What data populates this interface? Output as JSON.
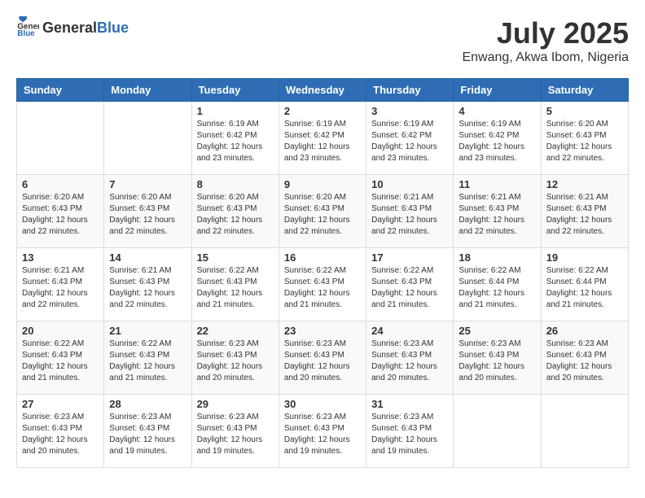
{
  "header": {
    "logo_general": "General",
    "logo_blue": "Blue",
    "month": "July 2025",
    "location": "Enwang, Akwa Ibom, Nigeria"
  },
  "weekdays": [
    "Sunday",
    "Monday",
    "Tuesday",
    "Wednesday",
    "Thursday",
    "Friday",
    "Saturday"
  ],
  "weeks": [
    [
      {
        "day": "",
        "detail": ""
      },
      {
        "day": "",
        "detail": ""
      },
      {
        "day": "1",
        "detail": "Sunrise: 6:19 AM\nSunset: 6:42 PM\nDaylight: 12 hours and 23 minutes."
      },
      {
        "day": "2",
        "detail": "Sunrise: 6:19 AM\nSunset: 6:42 PM\nDaylight: 12 hours and 23 minutes."
      },
      {
        "day": "3",
        "detail": "Sunrise: 6:19 AM\nSunset: 6:42 PM\nDaylight: 12 hours and 23 minutes."
      },
      {
        "day": "4",
        "detail": "Sunrise: 6:19 AM\nSunset: 6:42 PM\nDaylight: 12 hours and 23 minutes."
      },
      {
        "day": "5",
        "detail": "Sunrise: 6:20 AM\nSunset: 6:43 PM\nDaylight: 12 hours and 22 minutes."
      }
    ],
    [
      {
        "day": "6",
        "detail": "Sunrise: 6:20 AM\nSunset: 6:43 PM\nDaylight: 12 hours and 22 minutes."
      },
      {
        "day": "7",
        "detail": "Sunrise: 6:20 AM\nSunset: 6:43 PM\nDaylight: 12 hours and 22 minutes."
      },
      {
        "day": "8",
        "detail": "Sunrise: 6:20 AM\nSunset: 6:43 PM\nDaylight: 12 hours and 22 minutes."
      },
      {
        "day": "9",
        "detail": "Sunrise: 6:20 AM\nSunset: 6:43 PM\nDaylight: 12 hours and 22 minutes."
      },
      {
        "day": "10",
        "detail": "Sunrise: 6:21 AM\nSunset: 6:43 PM\nDaylight: 12 hours and 22 minutes."
      },
      {
        "day": "11",
        "detail": "Sunrise: 6:21 AM\nSunset: 6:43 PM\nDaylight: 12 hours and 22 minutes."
      },
      {
        "day": "12",
        "detail": "Sunrise: 6:21 AM\nSunset: 6:43 PM\nDaylight: 12 hours and 22 minutes."
      }
    ],
    [
      {
        "day": "13",
        "detail": "Sunrise: 6:21 AM\nSunset: 6:43 PM\nDaylight: 12 hours and 22 minutes."
      },
      {
        "day": "14",
        "detail": "Sunrise: 6:21 AM\nSunset: 6:43 PM\nDaylight: 12 hours and 22 minutes."
      },
      {
        "day": "15",
        "detail": "Sunrise: 6:22 AM\nSunset: 6:43 PM\nDaylight: 12 hours and 21 minutes."
      },
      {
        "day": "16",
        "detail": "Sunrise: 6:22 AM\nSunset: 6:43 PM\nDaylight: 12 hours and 21 minutes."
      },
      {
        "day": "17",
        "detail": "Sunrise: 6:22 AM\nSunset: 6:43 PM\nDaylight: 12 hours and 21 minutes."
      },
      {
        "day": "18",
        "detail": "Sunrise: 6:22 AM\nSunset: 6:44 PM\nDaylight: 12 hours and 21 minutes."
      },
      {
        "day": "19",
        "detail": "Sunrise: 6:22 AM\nSunset: 6:44 PM\nDaylight: 12 hours and 21 minutes."
      }
    ],
    [
      {
        "day": "20",
        "detail": "Sunrise: 6:22 AM\nSunset: 6:43 PM\nDaylight: 12 hours and 21 minutes."
      },
      {
        "day": "21",
        "detail": "Sunrise: 6:22 AM\nSunset: 6:43 PM\nDaylight: 12 hours and 21 minutes."
      },
      {
        "day": "22",
        "detail": "Sunrise: 6:23 AM\nSunset: 6:43 PM\nDaylight: 12 hours and 20 minutes."
      },
      {
        "day": "23",
        "detail": "Sunrise: 6:23 AM\nSunset: 6:43 PM\nDaylight: 12 hours and 20 minutes."
      },
      {
        "day": "24",
        "detail": "Sunrise: 6:23 AM\nSunset: 6:43 PM\nDaylight: 12 hours and 20 minutes."
      },
      {
        "day": "25",
        "detail": "Sunrise: 6:23 AM\nSunset: 6:43 PM\nDaylight: 12 hours and 20 minutes."
      },
      {
        "day": "26",
        "detail": "Sunrise: 6:23 AM\nSunset: 6:43 PM\nDaylight: 12 hours and 20 minutes."
      }
    ],
    [
      {
        "day": "27",
        "detail": "Sunrise: 6:23 AM\nSunset: 6:43 PM\nDaylight: 12 hours and 20 minutes."
      },
      {
        "day": "28",
        "detail": "Sunrise: 6:23 AM\nSunset: 6:43 PM\nDaylight: 12 hours and 19 minutes."
      },
      {
        "day": "29",
        "detail": "Sunrise: 6:23 AM\nSunset: 6:43 PM\nDaylight: 12 hours and 19 minutes."
      },
      {
        "day": "30",
        "detail": "Sunrise: 6:23 AM\nSunset: 6:43 PM\nDaylight: 12 hours and 19 minutes."
      },
      {
        "day": "31",
        "detail": "Sunrise: 6:23 AM\nSunset: 6:43 PM\nDaylight: 12 hours and 19 minutes."
      },
      {
        "day": "",
        "detail": ""
      },
      {
        "day": "",
        "detail": ""
      }
    ]
  ]
}
